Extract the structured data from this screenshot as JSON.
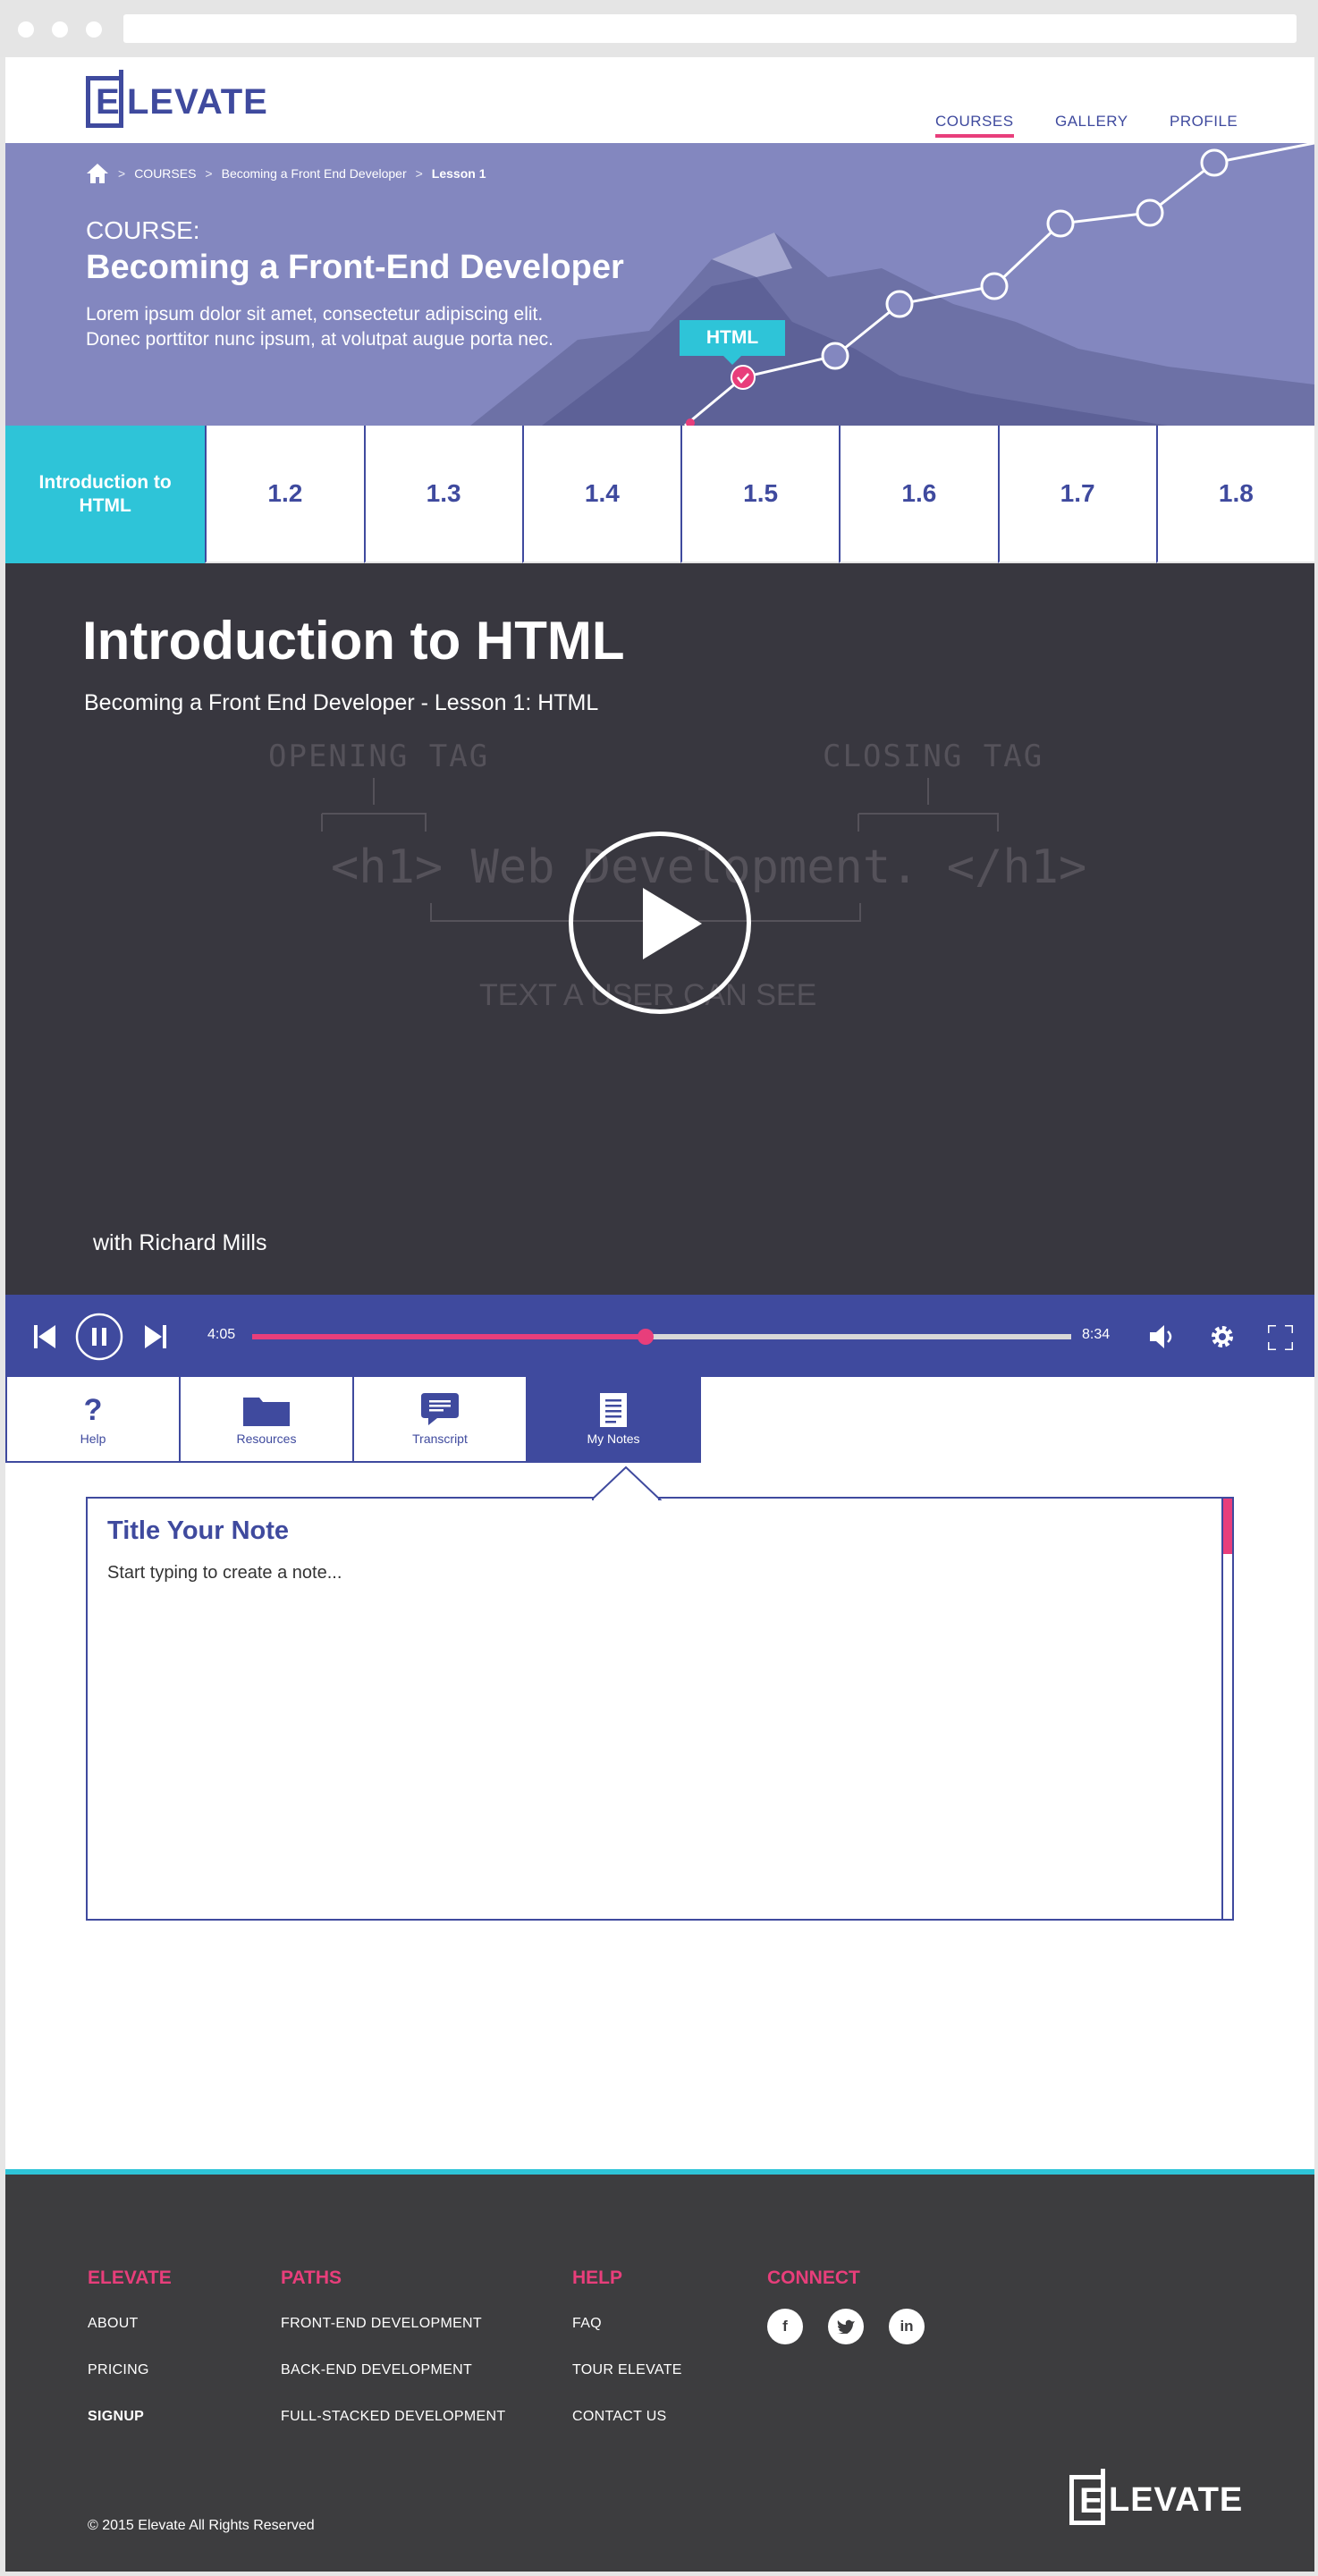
{
  "brand": {
    "logo_letter": "E",
    "logo_text": "LEVATE",
    "accent": "#3f4a9e",
    "pink": "#e83e7b",
    "cyan": "#2ec4d8"
  },
  "nav": {
    "courses": "COURSES",
    "gallery": "GALLERY",
    "profile": "PROFILE"
  },
  "breadcrumb": {
    "courses": "COURSES",
    "course": "Becoming a Front End Developer",
    "current": "Lesson 1"
  },
  "hero": {
    "label": "COURSE:",
    "title": "Becoming a Front-End Developer",
    "desc_line1": "Lorem ipsum dolor sit amet, consectetur adipiscing elit.",
    "desc_line2": "Donec porttitor nunc ipsum, at volutpat augue porta nec.",
    "tag": "HTML"
  },
  "lessons": [
    "Introduction to HTML",
    "1.2",
    "1.3",
    "1.4",
    "1.5",
    "1.6",
    "1.7",
    "1.8"
  ],
  "video": {
    "title": "Introduction to HTML",
    "subtitle": "Becoming a Front End Developer - Lesson 1: HTML",
    "opening_tag": "OPENING TAG",
    "closing_tag": "CLOSING TAG",
    "code": "<h1> Web Development. </h1>",
    "caption": "TEXT A USER CAN SEE",
    "presenter": "with Richard Mills"
  },
  "player": {
    "current_time": "4:05",
    "total_time": "8:34",
    "progress": 0.48
  },
  "tools": {
    "help": "Help",
    "help_glyph": "?",
    "resources": "Resources",
    "transcript": "Transcript",
    "notes": "My Notes"
  },
  "notes": {
    "title": "Title Your Note",
    "placeholder": "Start typing to create a note..."
  },
  "footer": {
    "col1": {
      "head": "ELEVATE",
      "links": [
        "ABOUT",
        "PRICING",
        "SIGNUP"
      ]
    },
    "col2": {
      "head": "PATHS",
      "links": [
        "FRONT-END DEVELOPMENT",
        "BACK-END DEVELOPMENT",
        "FULL-STACKED DEVELOPMENT"
      ]
    },
    "col3": {
      "head": "HELP",
      "links": [
        "FAQ",
        "TOUR ELEVATE",
        "CONTACT US"
      ]
    },
    "col4": {
      "head": "CONNECT",
      "social": [
        "f",
        "t",
        "in"
      ]
    },
    "copyright": "© 2015 Elevate All Rights Reserved"
  }
}
